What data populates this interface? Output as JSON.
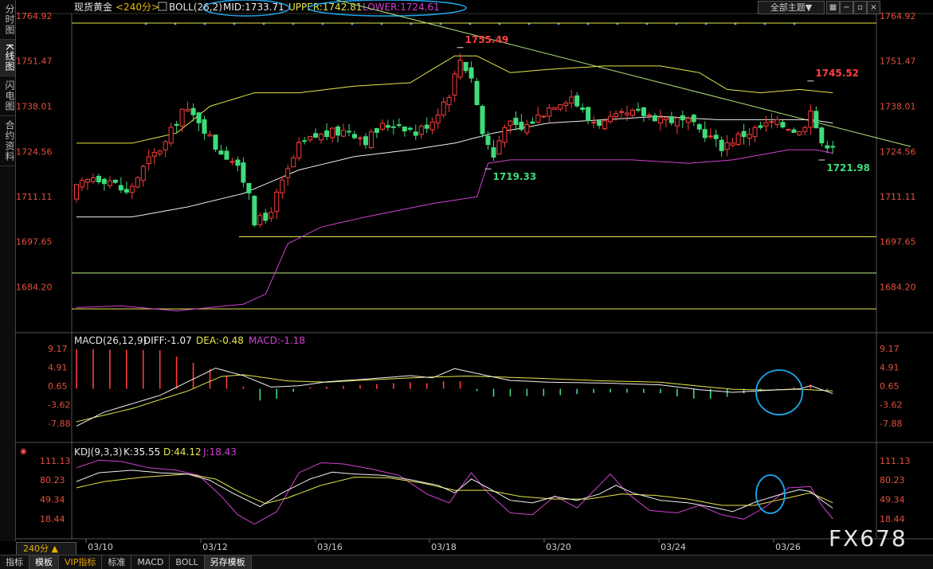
{
  "header": {
    "symbol": "现货黄金",
    "period": "<240分>",
    "boll_label": "BOLL(26,2)",
    "mid": "MID:1733.71",
    "upper": "UPPER:1742.81",
    "lower": "LOWER:1724.61",
    "theme_button": "全部主题▼",
    "icons": [
      "grid-icon",
      "minus-icon",
      "restore-icon",
      "close-icon"
    ]
  },
  "sidebar": {
    "items": [
      "分时图",
      "K线图",
      "闪电图",
      "合约资料"
    ],
    "active_index": 1
  },
  "bottom": {
    "period_box": "240分 ▲",
    "tabs": [
      "指标",
      "模板",
      "VIP指标",
      "标准",
      "MACD",
      "BOLL",
      "另存模板"
    ],
    "active_tab": 1,
    "dates": [
      "03/10",
      "03/12",
      "03/16",
      "03/18",
      "03/20",
      "03/24",
      "03/26"
    ]
  },
  "watermark": "FX678",
  "colors": {
    "up": "#ff3b3b",
    "down": "#3fdc7a",
    "mid": "#f0f0f0",
    "upper": "#e6e64a",
    "lower": "#d040d0",
    "trend": "#aee27a",
    "hline_yellow": "#e6e64a",
    "hline_green": "#b8f078",
    "dea": "#e6e64a",
    "macd_label": "#d040d0",
    "annot_high": "#ff4040",
    "annot_low": "#3fdc7a"
  },
  "chart_data": [
    {
      "type": "candlestick",
      "panel": "price",
      "y_ticks": [
        "1764.92",
        "1751.47",
        "1738.01",
        "1724.56",
        "1711.11",
        "1697.65",
        "1684.20"
      ],
      "ylim": [
        1675,
        1767.5
      ],
      "annotations": [
        {
          "label": "1755.49",
          "bar": 69,
          "value": 1755.49,
          "kind": "high"
        },
        {
          "label": "1719.33",
          "bar": 74,
          "value": 1719.33,
          "kind": "low"
        },
        {
          "label": "1745.52",
          "bar": 132,
          "value": 1745.52,
          "kind": "high"
        },
        {
          "label": "1721.98",
          "bar": 134,
          "value": 1721.98,
          "kind": "low"
        }
      ],
      "hlines": [
        {
          "value": 1762.8,
          "color": "hline_yellow"
        },
        {
          "value": 1699.1,
          "color": "hline_yellow"
        },
        {
          "value": 1688.3,
          "color": "hline_green"
        },
        {
          "value": 1677.6,
          "color": "hline_yellow"
        }
      ],
      "trendline": {
        "from": [
          46,
          1770.0
        ],
        "to": [
          150,
          1726.0
        ]
      },
      "kpoints": [
        [
          0,
          1713.5
        ],
        [
          3,
          1717
        ],
        [
          6,
          1716
        ],
        [
          9,
          1712
        ],
        [
          13,
          1722
        ],
        [
          16,
          1727
        ],
        [
          19,
          1737
        ],
        [
          22,
          1734
        ],
        [
          25,
          1726
        ],
        [
          28,
          1722
        ],
        [
          31,
          1713
        ],
        [
          32,
          1704
        ],
        [
          34,
          1704
        ],
        [
          37,
          1715
        ],
        [
          40,
          1726
        ],
        [
          43,
          1729
        ],
        [
          46,
          1730
        ],
        [
          49,
          1731
        ],
        [
          52,
          1728
        ],
        [
          55,
          1732
        ],
        [
          58,
          1733
        ],
        [
          61,
          1730
        ],
        [
          64,
          1734
        ],
        [
          67,
          1742
        ],
        [
          69,
          1752
        ],
        [
          71,
          1747
        ],
        [
          73,
          1730
        ],
        [
          75,
          1723
        ],
        [
          77,
          1733
        ],
        [
          80,
          1731
        ],
        [
          83,
          1735
        ],
        [
          86,
          1739
        ],
        [
          89,
          1741
        ],
        [
          92,
          1734
        ],
        [
          95,
          1733
        ],
        [
          98,
          1735
        ],
        [
          101,
          1736
        ],
        [
          104,
          1735
        ],
        [
          107,
          1734
        ],
        [
          110,
          1733
        ],
        [
          113,
          1730
        ],
        [
          116,
          1726
        ],
        [
          119,
          1729
        ],
        [
          122,
          1731
        ],
        [
          125,
          1733
        ],
        [
          128,
          1732
        ],
        [
          130,
          1730
        ],
        [
          131,
          1733
        ],
        [
          132,
          1738
        ],
        [
          133,
          1732
        ],
        [
          134,
          1726
        ],
        [
          135,
          1727
        ],
        [
          136,
          1727
        ]
      ],
      "mid_points": [
        [
          0,
          1705
        ],
        [
          10,
          1705
        ],
        [
          20,
          1708
        ],
        [
          30,
          1712
        ],
        [
          40,
          1719
        ],
        [
          50,
          1723
        ],
        [
          60,
          1725
        ],
        [
          68,
          1727
        ],
        [
          75,
          1730
        ],
        [
          85,
          1733
        ],
        [
          95,
          1734
        ],
        [
          105,
          1735
        ],
        [
          115,
          1734
        ],
        [
          125,
          1734
        ],
        [
          132,
          1734
        ],
        [
          136,
          1733
        ]
      ],
      "upper_points": [
        [
          0,
          1727
        ],
        [
          10,
          1727
        ],
        [
          18,
          1730
        ],
        [
          24,
          1738
        ],
        [
          32,
          1742
        ],
        [
          40,
          1742
        ],
        [
          50,
          1744
        ],
        [
          60,
          1745
        ],
        [
          68,
          1753
        ],
        [
          72,
          1753
        ],
        [
          78,
          1748
        ],
        [
          85,
          1749
        ],
        [
          95,
          1750
        ],
        [
          105,
          1750
        ],
        [
          112,
          1748
        ],
        [
          117,
          1743
        ],
        [
          123,
          1742
        ],
        [
          130,
          1743
        ],
        [
          136,
          1742
        ]
      ],
      "lower_points": [
        [
          0,
          1678
        ],
        [
          8,
          1678.5
        ],
        [
          18,
          1677
        ],
        [
          30,
          1679
        ],
        [
          34,
          1682
        ],
        [
          38,
          1697
        ],
        [
          44,
          1702
        ],
        [
          52,
          1705
        ],
        [
          58,
          1707
        ],
        [
          64,
          1709
        ],
        [
          72,
          1711
        ],
        [
          74,
          1721
        ],
        [
          78,
          1722
        ],
        [
          90,
          1722
        ],
        [
          100,
          1722
        ],
        [
          110,
          1721
        ],
        [
          118,
          1722
        ],
        [
          128,
          1725
        ],
        [
          133,
          1725
        ],
        [
          136,
          1724
        ]
      ]
    },
    {
      "type": "bar+line",
      "panel": "macd",
      "label": "MACD(26,12,9)",
      "diff_label": "DIFF:-1.07",
      "dea_label": "DEA:-0.48",
      "macd_label": "MACD:-1.18",
      "y_ticks": [
        "9.17",
        "4.91",
        "0.65",
        "-3.62",
        "-7.88"
      ],
      "ylim": [
        -10,
        11
      ],
      "hist_points": [
        [
          0,
          9.0
        ],
        [
          15,
          8.8
        ],
        [
          25,
          4.0
        ],
        [
          29,
          2.0
        ],
        [
          31,
          -1.0
        ],
        [
          34,
          -3.5
        ],
        [
          38,
          -1.0
        ],
        [
          42,
          0.3
        ],
        [
          50,
          0.8
        ],
        [
          60,
          1.5
        ],
        [
          64,
          1.2
        ],
        [
          68,
          2.3
        ],
        [
          70,
          1.2
        ],
        [
          72,
          -0.5
        ],
        [
          75,
          -1.8
        ],
        [
          85,
          -1.6
        ],
        [
          95,
          -0.8
        ],
        [
          105,
          -1.0
        ],
        [
          110,
          -2.2
        ],
        [
          115,
          -2.3
        ],
        [
          122,
          -0.6
        ],
        [
          128,
          0.2
        ],
        [
          132,
          0.9
        ],
        [
          136,
          -0.6
        ]
      ],
      "diff_points": [
        [
          0,
          -8.5
        ],
        [
          5,
          -5.3
        ],
        [
          15,
          -1.5
        ],
        [
          25,
          4.7
        ],
        [
          30,
          3.0
        ],
        [
          35,
          0.4
        ],
        [
          40,
          0.7
        ],
        [
          45,
          1.6
        ],
        [
          52,
          2.2
        ],
        [
          60,
          3.0
        ],
        [
          64,
          2.5
        ],
        [
          68,
          4.6
        ],
        [
          72,
          3.5
        ],
        [
          78,
          1.9
        ],
        [
          85,
          1.5
        ],
        [
          95,
          1.3
        ],
        [
          105,
          0.9
        ],
        [
          112,
          -0.2
        ],
        [
          118,
          -0.8
        ],
        [
          125,
          -0.3
        ],
        [
          130,
          0.0
        ],
        [
          132,
          0.7
        ],
        [
          136,
          -1.07
        ]
      ],
      "dea_points": [
        [
          0,
          -7.5
        ],
        [
          10,
          -4.5
        ],
        [
          20,
          -0.5
        ],
        [
          26,
          2.8
        ],
        [
          30,
          3.2
        ],
        [
          38,
          1.8
        ],
        [
          45,
          1.5
        ],
        [
          52,
          2.0
        ],
        [
          62,
          2.6
        ],
        [
          70,
          2.9
        ],
        [
          76,
          2.7
        ],
        [
          85,
          2.3
        ],
        [
          95,
          1.8
        ],
        [
          105,
          1.5
        ],
        [
          112,
          0.6
        ],
        [
          118,
          -0.1
        ],
        [
          124,
          -0.3
        ],
        [
          130,
          -0.1
        ],
        [
          136,
          -0.48
        ]
      ]
    },
    {
      "type": "line",
      "panel": "kdj",
      "label": "KDJ(9,3,3)",
      "k_label": "K:35.55",
      "d_label": "D:44.12",
      "j_label": "J:18.43",
      "y_ticks": [
        "111.13",
        "80.23",
        "49.34",
        "18.44"
      ],
      "ylim": [
        0,
        120
      ],
      "k_points": [
        [
          0,
          78
        ],
        [
          4,
          92
        ],
        [
          10,
          96
        ],
        [
          15,
          92
        ],
        [
          20,
          90
        ],
        [
          24,
          80
        ],
        [
          28,
          60
        ],
        [
          33,
          38
        ],
        [
          37,
          60
        ],
        [
          42,
          82
        ],
        [
          46,
          93
        ],
        [
          50,
          90
        ],
        [
          55,
          88
        ],
        [
          60,
          81
        ],
        [
          65,
          72
        ],
        [
          68,
          60
        ],
        [
          71,
          82
        ],
        [
          74,
          68
        ],
        [
          78,
          48
        ],
        [
          82,
          44
        ],
        [
          86,
          54
        ],
        [
          90,
          48
        ],
        [
          94,
          58
        ],
        [
          97,
          72
        ],
        [
          100,
          60
        ],
        [
          105,
          48
        ],
        [
          110,
          44
        ],
        [
          115,
          36
        ],
        [
          118,
          30
        ],
        [
          122,
          45
        ],
        [
          126,
          56
        ],
        [
          130,
          65
        ],
        [
          132,
          62
        ],
        [
          134,
          48
        ],
        [
          136,
          35.55
        ]
      ],
      "d_points": [
        [
          0,
          68
        ],
        [
          5,
          78
        ],
        [
          12,
          85
        ],
        [
          20,
          90
        ],
        [
          25,
          82
        ],
        [
          30,
          58
        ],
        [
          34,
          43
        ],
        [
          38,
          52
        ],
        [
          44,
          72
        ],
        [
          50,
          85
        ],
        [
          56,
          84
        ],
        [
          62,
          76
        ],
        [
          68,
          64
        ],
        [
          74,
          64
        ],
        [
          80,
          54
        ],
        [
          86,
          50
        ],
        [
          92,
          50
        ],
        [
          98,
          58
        ],
        [
          104,
          56
        ],
        [
          110,
          50
        ],
        [
          116,
          40
        ],
        [
          122,
          40
        ],
        [
          128,
          52
        ],
        [
          132,
          60
        ],
        [
          136,
          44.12
        ]
      ],
      "j_points": [
        [
          0,
          100
        ],
        [
          4,
          112
        ],
        [
          8,
          110
        ],
        [
          13,
          100
        ],
        [
          18,
          96
        ],
        [
          22,
          88
        ],
        [
          26,
          55
        ],
        [
          29,
          25
        ],
        [
          32,
          10
        ],
        [
          36,
          30
        ],
        [
          40,
          92
        ],
        [
          44,
          108
        ],
        [
          48,
          106
        ],
        [
          53,
          98
        ],
        [
          58,
          88
        ],
        [
          63,
          58
        ],
        [
          67,
          44
        ],
        [
          71,
          92
        ],
        [
          74,
          60
        ],
        [
          78,
          28
        ],
        [
          82,
          25
        ],
        [
          86,
          55
        ],
        [
          90,
          36
        ],
        [
          94,
          72
        ],
        [
          96,
          90
        ],
        [
          99,
          60
        ],
        [
          103,
          32
        ],
        [
          108,
          28
        ],
        [
          112,
          40
        ],
        [
          116,
          25
        ],
        [
          120,
          18
        ],
        [
          124,
          38
        ],
        [
          128,
          68
        ],
        [
          132,
          70
        ],
        [
          134,
          40
        ],
        [
          136,
          18.43
        ]
      ]
    }
  ]
}
